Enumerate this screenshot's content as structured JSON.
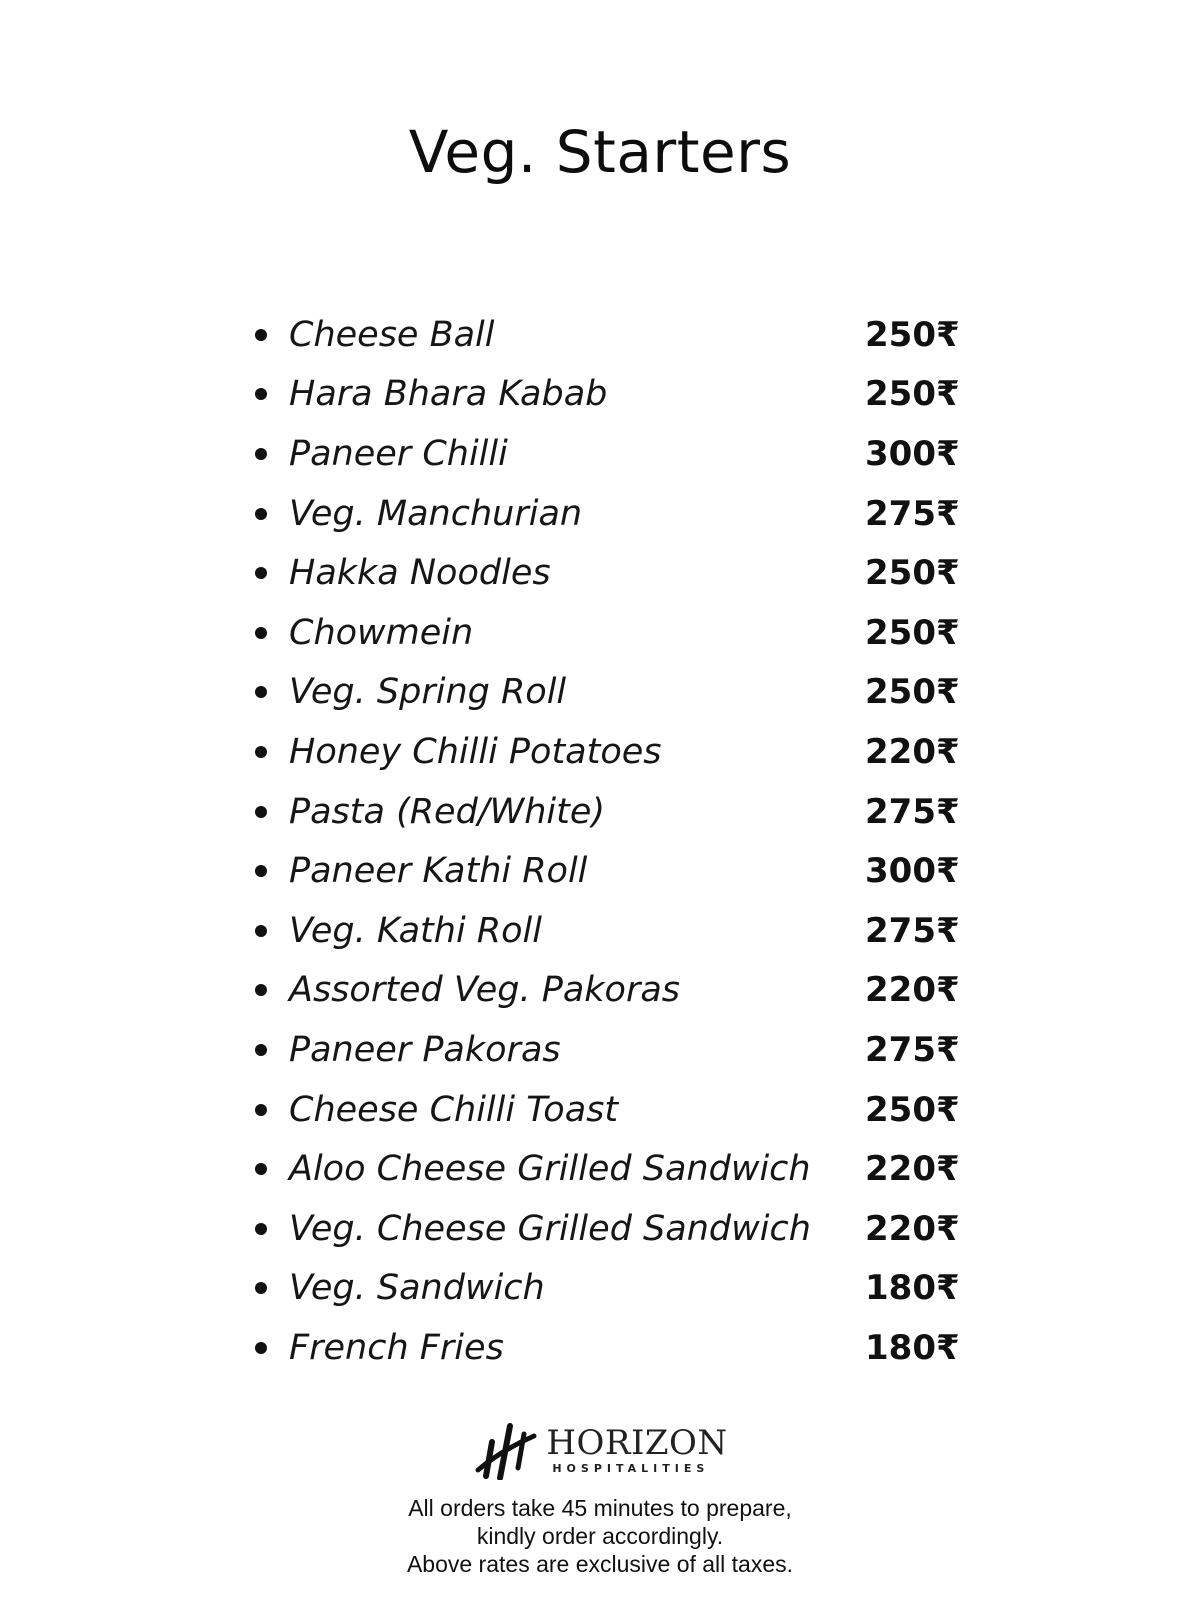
{
  "title": "Veg. Starters",
  "items": [
    {
      "name": "Cheese Ball",
      "price": "250₹"
    },
    {
      "name": "Hara Bhara Kabab",
      "price": "250₹"
    },
    {
      "name": "Paneer Chilli",
      "price": "300₹"
    },
    {
      "name": "Veg. Manchurian",
      "price": "275₹"
    },
    {
      "name": "Hakka Noodles",
      "price": "250₹"
    },
    {
      "name": "Chowmein",
      "price": "250₹"
    },
    {
      "name": "Veg. Spring Roll",
      "price": "250₹"
    },
    {
      "name": "Honey Chilli Potatoes",
      "price": "220₹"
    },
    {
      "name": "Pasta (Red/White)",
      "price": "275₹"
    },
    {
      "name": "Paneer Kathi Roll",
      "price": "300₹"
    },
    {
      "name": "Veg. Kathi Roll",
      "price": "275₹"
    },
    {
      "name": "Assorted Veg. Pakoras",
      "price": "220₹"
    },
    {
      "name": "Paneer Pakoras",
      "price": "275₹"
    },
    {
      "name": "Cheese Chilli Toast",
      "price": "250₹"
    },
    {
      "name": "Aloo Cheese Grilled Sandwich",
      "price": "220₹"
    },
    {
      "name": "Veg. Cheese Grilled Sandwich",
      "price": "220₹"
    },
    {
      "name": "Veg. Sandwich",
      "price": "180₹"
    },
    {
      "name": "French Fries",
      "price": "180₹"
    }
  ],
  "logo": {
    "icon": "horizon-hh-logo-icon",
    "brand": "HORIZON",
    "sub": "HOSPITALITIES"
  },
  "notes": [
    "All orders take 45 minutes to prepare,",
    "kindly order accordingly.",
    "Above rates are exclusive of all taxes."
  ]
}
